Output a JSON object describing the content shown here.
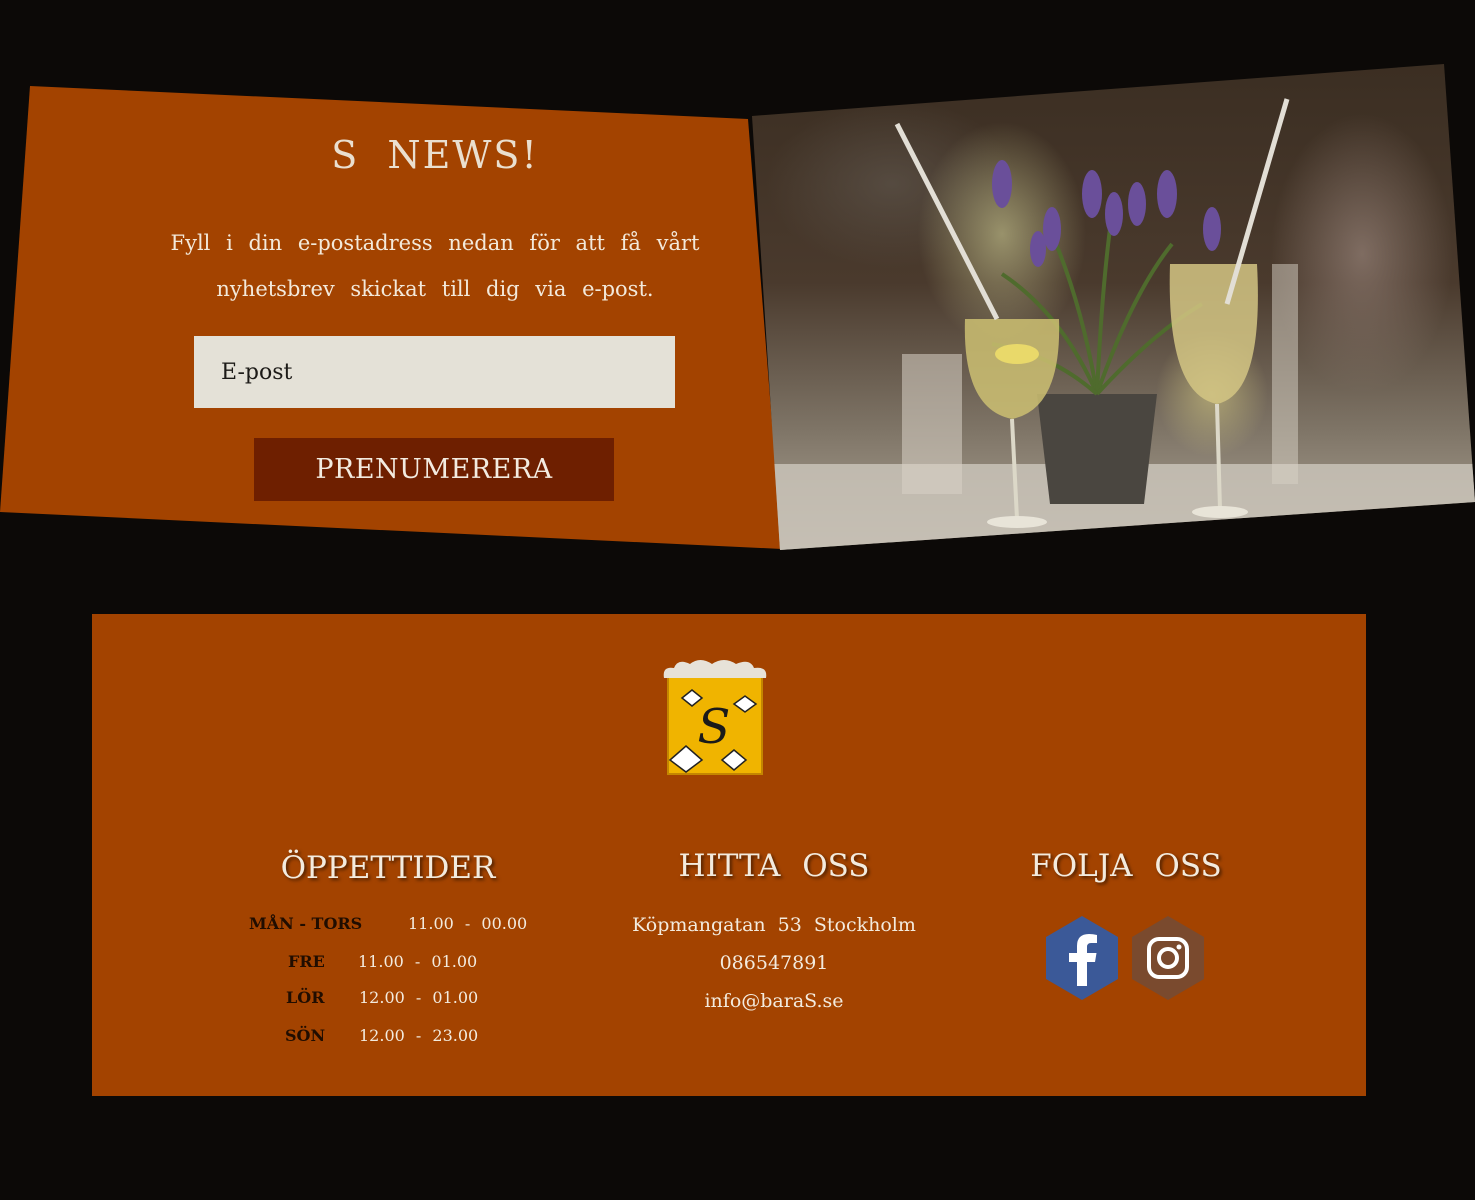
{
  "newsletter": {
    "title": "S NEWS!",
    "description": "Fyll i din e-postadress nedan för att få vårt nyhetsbrev skickat till dig via e-post.",
    "email_placeholder": "E-post",
    "subscribe_label": "PRENUMERERA"
  },
  "footer": {
    "logo_letter": "S",
    "hours": {
      "title": "ÖPPETTIDER",
      "rows": [
        {
          "day": "MÅN - TORS",
          "time": "11.00 - 00.00"
        },
        {
          "day": "FRE",
          "time": "11.00 - 01.00"
        },
        {
          "day": "LÖR",
          "time": "12.00 - 01.00"
        },
        {
          "day": "SÖN",
          "time": "12.00 - 23.00"
        }
      ]
    },
    "find_us": {
      "title": "HITTA OSS",
      "address": "Köpmangatan 53 Stockholm",
      "phone": "086547891",
      "email": "info@baraS.se"
    },
    "follow_us": {
      "title": "FOLJA OSS",
      "facebook_icon": "facebook-icon",
      "instagram_icon": "instagram-icon",
      "facebook_color": "#3b5998",
      "instagram_color": "#7a4a2e"
    }
  },
  "colors": {
    "background": "#0c0907",
    "panel": "#a34300",
    "button": "#6e1f00",
    "input": "#e4e1d7"
  }
}
